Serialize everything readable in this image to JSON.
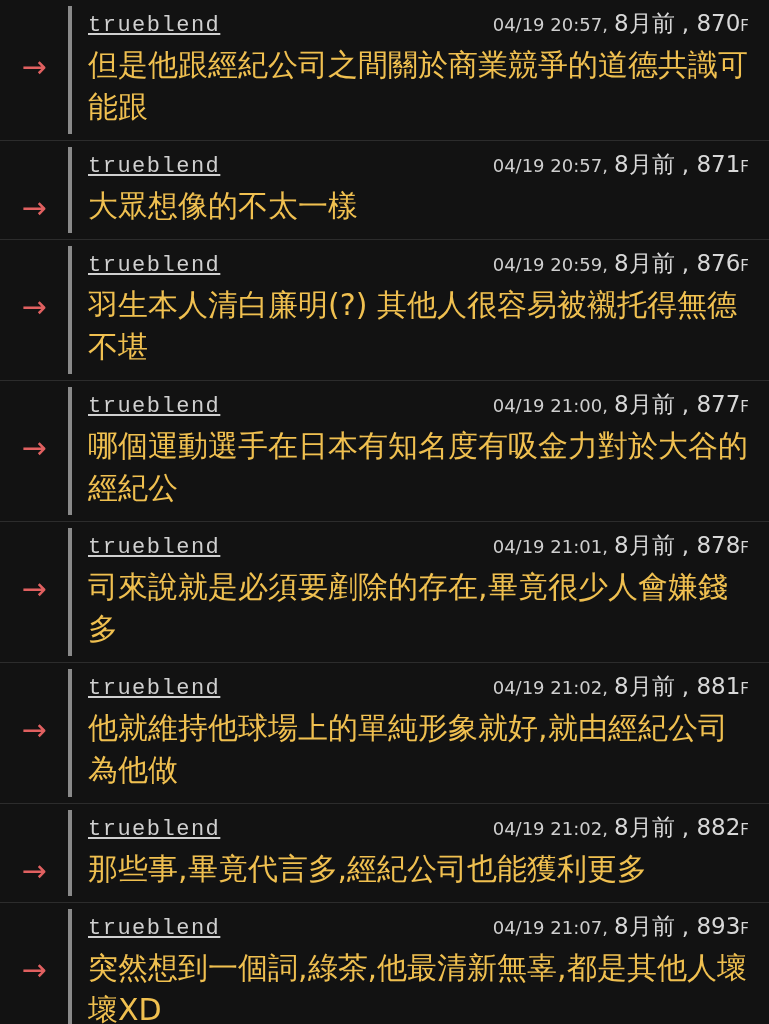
{
  "comments": [
    {
      "marker": "→",
      "user": "trueblend",
      "time": "04/19 20:57,",
      "age_floor": "8月前 , 870",
      "floor_mark": "F",
      "text": "但是他跟經紀公司之間關於商業競爭的道德共識可能跟"
    },
    {
      "marker": "→",
      "user": "trueblend",
      "time": "04/19 20:57,",
      "age_floor": "8月前 , 871",
      "floor_mark": "F",
      "text": "大眾想像的不太一樣"
    },
    {
      "marker": "→",
      "user": "trueblend",
      "time": "04/19 20:59,",
      "age_floor": "8月前 , 876",
      "floor_mark": "F",
      "text": "羽生本人清白廉明(?) 其他人很容易被襯托得無德不堪"
    },
    {
      "marker": "→",
      "user": "trueblend",
      "time": "04/19 21:00,",
      "age_floor": "8月前 , 877",
      "floor_mark": "F",
      "text": "哪個運動選手在日本有知名度有吸金力對於大谷的經紀公"
    },
    {
      "marker": "→",
      "user": "trueblend",
      "time": "04/19 21:01,",
      "age_floor": "8月前 , 878",
      "floor_mark": "F",
      "text": "司來說就是必須要剷除的存在,畢竟很少人會嫌錢多"
    },
    {
      "marker": "→",
      "user": "trueblend",
      "time": "04/19 21:02,",
      "age_floor": "8月前 , 881",
      "floor_mark": "F",
      "text": "他就維持他球場上的單純形象就好,就由經紀公司為他做"
    },
    {
      "marker": "→",
      "user": "trueblend",
      "time": "04/19 21:02,",
      "age_floor": "8月前 , 882",
      "floor_mark": "F",
      "text": "那些事,畢竟代言多,經紀公司也能獲利更多"
    },
    {
      "marker": "→",
      "user": "trueblend",
      "time": "04/19 21:07,",
      "age_floor": "8月前 , 893",
      "floor_mark": "F",
      "text": "突然想到一個詞,綠茶,他最清新無辜,都是其他人壞壞XD"
    }
  ]
}
